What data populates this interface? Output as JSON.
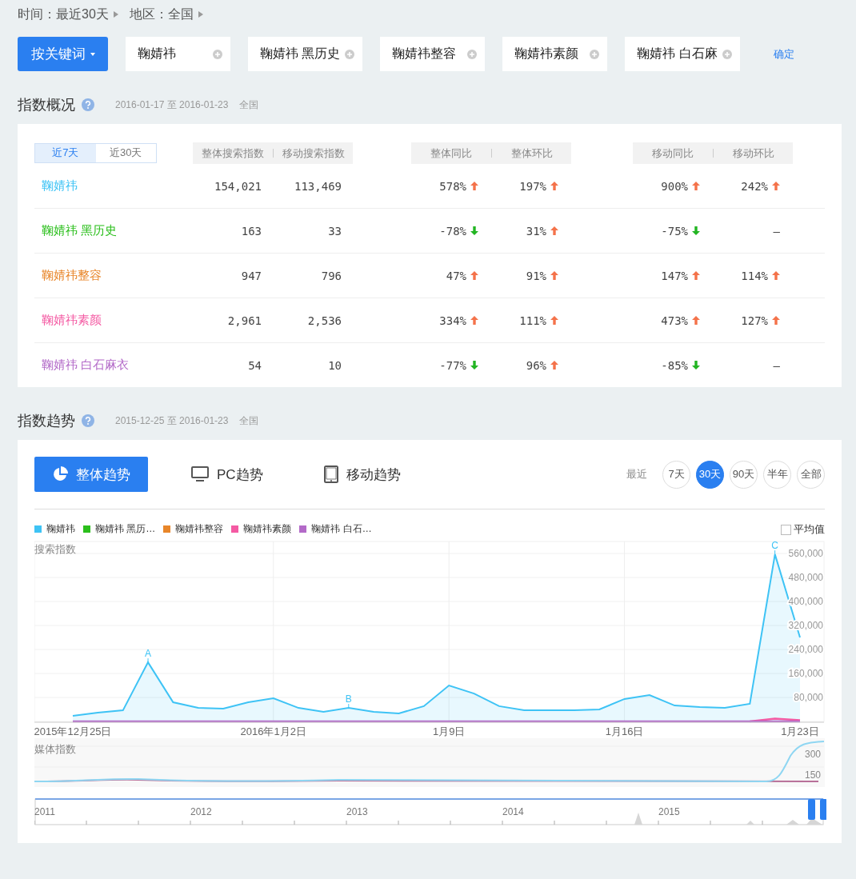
{
  "filters": [
    {
      "text": "时间：最近30天"
    },
    {
      "text": "地区：全国"
    }
  ],
  "search": {
    "mode_button": "按关键词",
    "keywords": [
      "鞠婧祎",
      "鞠婧祎 黑历史",
      "鞠婧祎整容",
      "鞠婧祎素颜",
      "鞠婧祎 白石麻"
    ],
    "confirm": "确定"
  },
  "overview": {
    "title": "指数概况",
    "date_range": "2016-01-17 至 2016-01-23",
    "region": "全国",
    "periods": [
      {
        "label": "近7天",
        "selected": true
      },
      {
        "label": "近30天",
        "selected": false
      }
    ],
    "header_groups": [
      [
        "整体搜索指数",
        "移动搜索指数"
      ],
      [
        "整体同比",
        "整体环比"
      ],
      [
        "移动同比",
        "移动环比"
      ]
    ],
    "rows": [
      {
        "keyword": "鞠婧祎",
        "color": "#3ec3f5",
        "total": "154,021",
        "mobile": "113,469",
        "cells": [
          {
            "text": "578%",
            "kind": "up"
          },
          {
            "text": "197%",
            "kind": "up"
          },
          {
            "text": "900%",
            "kind": "up"
          },
          {
            "text": "242%",
            "kind": "up"
          }
        ]
      },
      {
        "keyword": "鞠婧祎 黑历史",
        "color": "#2bbf1c",
        "total": "163",
        "mobile": "33",
        "cells": [
          {
            "text": "-78%",
            "kind": "down"
          },
          {
            "text": "31%",
            "kind": "up"
          },
          {
            "text": "-75%",
            "kind": "down"
          },
          {
            "text": "–",
            "kind": "none"
          }
        ]
      },
      {
        "keyword": "鞠婧祎整容",
        "color": "#e8862a",
        "total": "947",
        "mobile": "796",
        "cells": [
          {
            "text": "47%",
            "kind": "up"
          },
          {
            "text": "91%",
            "kind": "up"
          },
          {
            "text": "147%",
            "kind": "up"
          },
          {
            "text": "114%",
            "kind": "up"
          }
        ]
      },
      {
        "keyword": "鞠婧祎素颜",
        "color": "#f45aa3",
        "total": "2,961",
        "mobile": "2,536",
        "cells": [
          {
            "text": "334%",
            "kind": "up"
          },
          {
            "text": "111%",
            "kind": "up"
          },
          {
            "text": "473%",
            "kind": "up"
          },
          {
            "text": "127%",
            "kind": "up"
          }
        ]
      },
      {
        "keyword": "鞠婧祎 白石麻衣",
        "color": "#b36ac8",
        "total": "54",
        "mobile": "10",
        "cells": [
          {
            "text": "-77%",
            "kind": "down"
          },
          {
            "text": "96%",
            "kind": "up"
          },
          {
            "text": "-85%",
            "kind": "down"
          },
          {
            "text": "–",
            "kind": "none"
          }
        ]
      }
    ]
  },
  "trend": {
    "title": "指数趋势",
    "date_range": "2015-12-25 至 2016-01-23",
    "region": "全国",
    "tabs": [
      {
        "label": "整体趋势",
        "kind": "overall",
        "selected": true
      },
      {
        "label": "PC趋势",
        "kind": "pc",
        "selected": false
      },
      {
        "label": "移动趋势",
        "kind": "mobile",
        "selected": false
      }
    ],
    "range_label": "最近",
    "ranges": [
      {
        "label": "7天",
        "selected": false
      },
      {
        "label": "30天",
        "selected": true
      },
      {
        "label": "90天",
        "selected": false
      },
      {
        "label": "半年",
        "selected": false
      },
      {
        "label": "全部",
        "selected": false
      }
    ],
    "legend": [
      {
        "label": "鞠婧祎",
        "color": "#3ec3f5"
      },
      {
        "label": "鞠婧祎 黑历…",
        "color": "#2bbf1c"
      },
      {
        "label": "鞠婧祎整容",
        "color": "#e8862a"
      },
      {
        "label": "鞠婧祎素颜",
        "color": "#f45aa3"
      },
      {
        "label": "鞠婧祎 白石…",
        "color": "#b36ac8"
      }
    ],
    "average": {
      "label": "平均值",
      "checked": false
    },
    "chart_data": {
      "type": "area",
      "ylabel": "搜索指数",
      "grid": true,
      "categories": [
        "2015年12月25日",
        null,
        null,
        null,
        null,
        null,
        null,
        null,
        "2016年1月2日",
        null,
        null,
        null,
        null,
        null,
        null,
        "1月9日",
        null,
        null,
        null,
        null,
        null,
        null,
        "1月16日",
        null,
        null,
        null,
        null,
        null,
        null,
        "1月23日"
      ],
      "ylim": [
        0,
        600000
      ],
      "yticks": [
        {
          "value": 80000,
          "label": "80,000"
        },
        {
          "value": 160000,
          "label": "160,000"
        },
        {
          "value": 240000,
          "label": "240,000"
        },
        {
          "value": 320000,
          "label": "320,000"
        },
        {
          "value": 400000,
          "label": "400,000"
        },
        {
          "value": 480000,
          "label": "480,000"
        },
        {
          "value": 560000,
          "label": "560,000"
        }
      ],
      "series": [
        {
          "color": "#3ec3f5",
          "values": [
            19000,
            29000,
            37000,
            197000,
            64000,
            45000,
            43000,
            64000,
            77000,
            45000,
            32000,
            45000,
            32000,
            27000,
            51000,
            120000,
            93000,
            51000,
            37000,
            37000,
            37000,
            40000,
            75000,
            88000,
            53000,
            48000,
            45000,
            59000,
            557000,
            280000
          ]
        },
        {
          "color": "#f45aa3",
          "type": "line",
          "values": [
            null,
            null,
            null,
            null,
            null,
            null,
            null,
            null,
            null,
            null,
            null,
            null,
            null,
            null,
            null,
            null,
            null,
            null,
            null,
            null,
            null,
            null,
            null,
            null,
            null,
            null,
            null,
            0,
            9000,
            4000
          ]
        },
        {
          "color": "#b36ac8",
          "type": "line",
          "values": [
            0,
            0,
            0,
            0,
            0,
            0,
            0,
            0,
            0,
            0,
            0,
            0,
            0,
            0,
            0,
            0,
            0,
            0,
            0,
            0,
            0,
            0,
            0,
            0,
            0,
            0,
            0,
            0,
            0,
            0
          ]
        }
      ],
      "annotations": [
        "A",
        "B",
        "C"
      ]
    },
    "media": {
      "label": "媒体指数",
      "ticks": [
        "300",
        "150"
      ]
    },
    "navigator": {
      "years": [
        "2011",
        "2012",
        "2013",
        "2014",
        "2015"
      ]
    }
  }
}
